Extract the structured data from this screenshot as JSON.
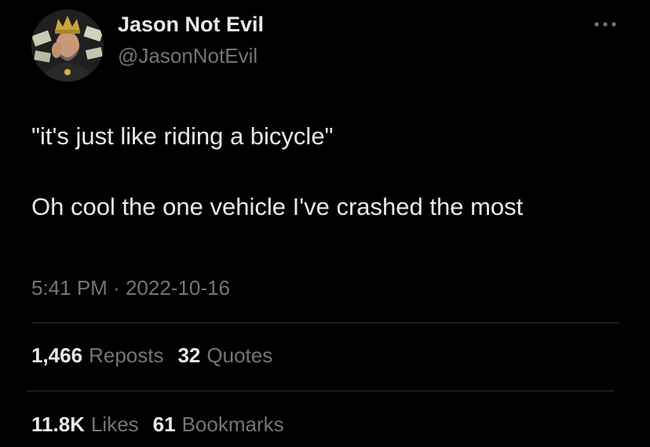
{
  "author": {
    "display_name": "Jason Not Evil",
    "handle": "@JasonNotEvil"
  },
  "tweet": {
    "lines": [
      "\"it's just like riding a bicycle\"",
      "Oh cool the one vehicle I've crashed the most"
    ],
    "time": "5:41 PM",
    "separator": "·",
    "date": "2022-10-16"
  },
  "stats": {
    "reposts": {
      "count": "1,466",
      "label": "Reposts"
    },
    "quotes": {
      "count": "32",
      "label": "Quotes"
    },
    "likes": {
      "count": "11.8K",
      "label": "Likes"
    },
    "bookmarks": {
      "count": "61",
      "label": "Bookmarks"
    }
  },
  "icons": {
    "more": "more-horizontal-icon",
    "avatar": "user-avatar"
  },
  "colors": {
    "background": "#000000",
    "text_primary": "#e7e9ea",
    "text_secondary": "#71767b",
    "divider": "#2f3336"
  }
}
